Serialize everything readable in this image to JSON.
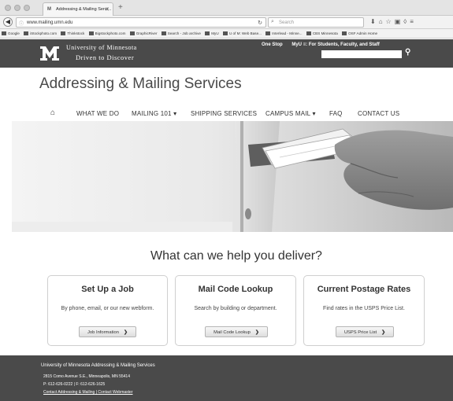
{
  "browser": {
    "tab_title": "Addressing & Mailing Servi...",
    "url": "www.mailing.umn.edu",
    "search_placeholder": "Search",
    "bookmarks": [
      "Google",
      "iStockphoto.com",
      "Thinkstock",
      "Bigstockphoto.com",
      "GraphicRiver",
      "Search - Job archive",
      "MyU",
      "U of M: Web Base...",
      "Interlead - Minne...",
      "CBS Minnesota",
      "OSF Admin Home"
    ]
  },
  "umn": {
    "name": "University of Minnesota",
    "tagline": "Driven to Discover",
    "links": [
      "One Stop",
      "MyU ≡: For Students, Faculty, and Staff"
    ]
  },
  "site": {
    "title": "Addressing & Mailing Services"
  },
  "nav": {
    "items": [
      "WHAT WE DO",
      "MAILING 101 ▾",
      "SHIPPING SERVICES",
      "CAMPUS MAIL ▾",
      "FAQ",
      "CONTACT US"
    ]
  },
  "help": {
    "title": "What can we help you deliver?",
    "cards": [
      {
        "title": "Set Up a Job",
        "text": "By phone, email, or our new webform.",
        "button": "Job Information"
      },
      {
        "title": "Mail Code Lookup",
        "text": "Search by building or department.",
        "button": "Mail Code Lookup"
      },
      {
        "title": "Current Postage Rates",
        "text": "Find rates in the USPS Price List.",
        "button": "USPS Price List"
      }
    ]
  },
  "footer": {
    "org": "University of Minnesota Addressing & Mailing Services",
    "address": "2815 Como Avenue S.E., Minneapolis, MN 55414",
    "phone": "P: 612-626-0222 | F: 612-626-1625",
    "contact1": "Contact Addressing & Mailing",
    "contact2": "Contact Webmaster"
  }
}
